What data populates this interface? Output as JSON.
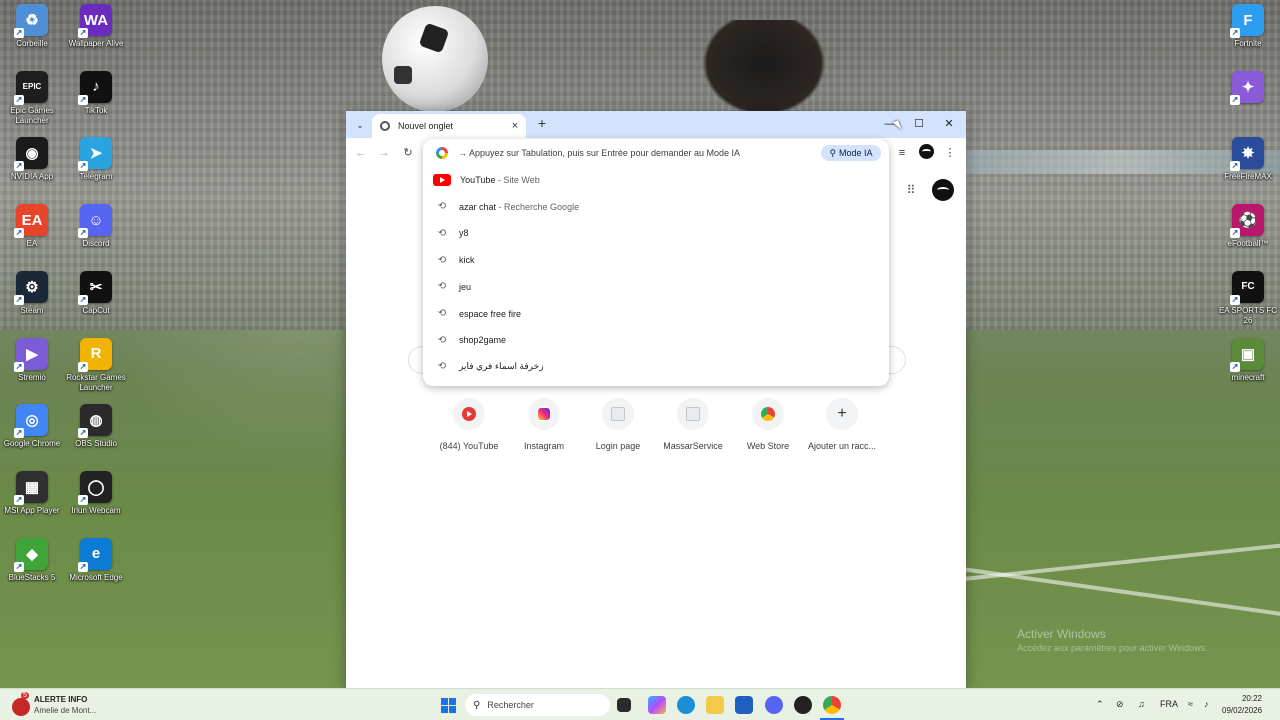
{
  "desktop": {
    "left_icons": [
      {
        "label": "Corbeille",
        "icon": "recycle-bin-icon",
        "color": "#4f8fd6",
        "glyph": "♻"
      },
      {
        "label": "Wallpaper Alive",
        "icon": "wallpaper-alive-icon",
        "color": "#6a2bbf",
        "glyph": "WA"
      },
      {
        "label": "Epic Games Launcher",
        "icon": "epic-games-icon",
        "color": "#1e1e1e",
        "glyph": "EPIC"
      },
      {
        "label": "TikTok",
        "icon": "tiktok-icon",
        "color": "#111111",
        "glyph": "♪"
      },
      {
        "label": "NVIDIA App",
        "icon": "nvidia-icon",
        "color": "#1b1b1b",
        "glyph": "◉"
      },
      {
        "label": "Telegram",
        "icon": "telegram-icon",
        "color": "#2aa3df",
        "glyph": "➤"
      },
      {
        "label": "EA",
        "icon": "ea-icon",
        "color": "#e8442c",
        "glyph": "EA"
      },
      {
        "label": "Discord",
        "icon": "discord-icon",
        "color": "#5865f2",
        "glyph": "☺"
      },
      {
        "label": "Steam",
        "icon": "steam-icon",
        "color": "#1b2838",
        "glyph": "⚙"
      },
      {
        "label": "CapCut",
        "icon": "capcut-icon",
        "color": "#111111",
        "glyph": "✂"
      },
      {
        "label": "Stremio",
        "icon": "stremio-icon",
        "color": "#7b5bd6",
        "glyph": "▶"
      },
      {
        "label": "Rockstar Games Launcher",
        "icon": "rockstar-icon",
        "color": "#f0b400",
        "glyph": "R"
      },
      {
        "label": "Google Chrome",
        "icon": "chrome-icon",
        "color": "#4285f4",
        "glyph": "◎"
      },
      {
        "label": "OBS Studio",
        "icon": "obs-icon",
        "color": "#2b2b2b",
        "glyph": "◍"
      },
      {
        "label": "MSI App Player",
        "icon": "msi-app-player-icon",
        "color": "#303030",
        "glyph": "▦"
      },
      {
        "label": "Iriun Webcam",
        "icon": "iriun-webcam-icon",
        "color": "#222222",
        "glyph": "◯"
      },
      {
        "label": "BlueStacks 5",
        "icon": "bluestacks-icon",
        "color": "#3fa53b",
        "glyph": "◆"
      },
      {
        "label": "Microsoft Edge",
        "icon": "edge-icon",
        "color": "#0c7bd3",
        "glyph": "e"
      }
    ],
    "right_icons": [
      {
        "label": "Fortnite",
        "icon": "fortnite-icon",
        "color": "#2d9df0",
        "glyph": "F"
      },
      {
        "label": "",
        "icon": "game-icon",
        "color": "#8a5ad8",
        "glyph": "✦"
      },
      {
        "label": "FreeFireMAX",
        "icon": "free-fire-icon",
        "color": "#2a4c9a",
        "glyph": "✸"
      },
      {
        "label": "eFootball™",
        "icon": "efootball-icon",
        "color": "#b8176b",
        "glyph": "⚽"
      },
      {
        "label": "EA SPORTS FC 26",
        "icon": "ea-sports-fc-icon",
        "color": "#111111",
        "glyph": "FC"
      },
      {
        "label": "minecraft",
        "icon": "minecraft-icon",
        "color": "#5a8a3a",
        "glyph": "▣"
      }
    ],
    "watermark_title": "Activer Windows",
    "watermark_sub": "Accédez aux paramètres pour activer Windows."
  },
  "browser": {
    "tab_title": "Nouvel onglet",
    "omnibox_hint": "→ Appuyez sur Tabulation, puis sur Entrée pour demander au Mode IA",
    "mode_ia_label": "Mode IA",
    "suggestions": [
      {
        "text": "YouTube",
        "sub": " - Site Web",
        "icon": "youtube"
      },
      {
        "text": "azar chat",
        "sub": " - Recherche Google",
        "icon": "history"
      },
      {
        "text": "y8",
        "sub": "",
        "icon": "history"
      },
      {
        "text": "kick",
        "sub": "",
        "icon": "history"
      },
      {
        "text": "jeu",
        "sub": "",
        "icon": "history"
      },
      {
        "text": "espace free fire",
        "sub": "",
        "icon": "history"
      },
      {
        "text": "shop2game",
        "sub": "",
        "icon": "history"
      },
      {
        "text": "زخرفة اسماء فري فاير",
        "sub": "",
        "icon": "history"
      }
    ],
    "shortcuts": [
      {
        "label": "(844) YouTube",
        "icon": "youtube"
      },
      {
        "label": "Instagram",
        "icon": "instagram"
      },
      {
        "label": "Login page",
        "icon": "page"
      },
      {
        "label": "MassarService",
        "icon": "page"
      },
      {
        "label": "Web Store",
        "icon": "store"
      },
      {
        "label": "Ajouter un racc...",
        "icon": "plus"
      }
    ]
  },
  "taskbar": {
    "alert_title": "ALERTE INFO",
    "alert_sub": "Amelie de Mont...",
    "alert_count": "5",
    "search_label": "Rechercher",
    "language": "FRA",
    "time": "20:22",
    "date": "09/02/2026"
  }
}
